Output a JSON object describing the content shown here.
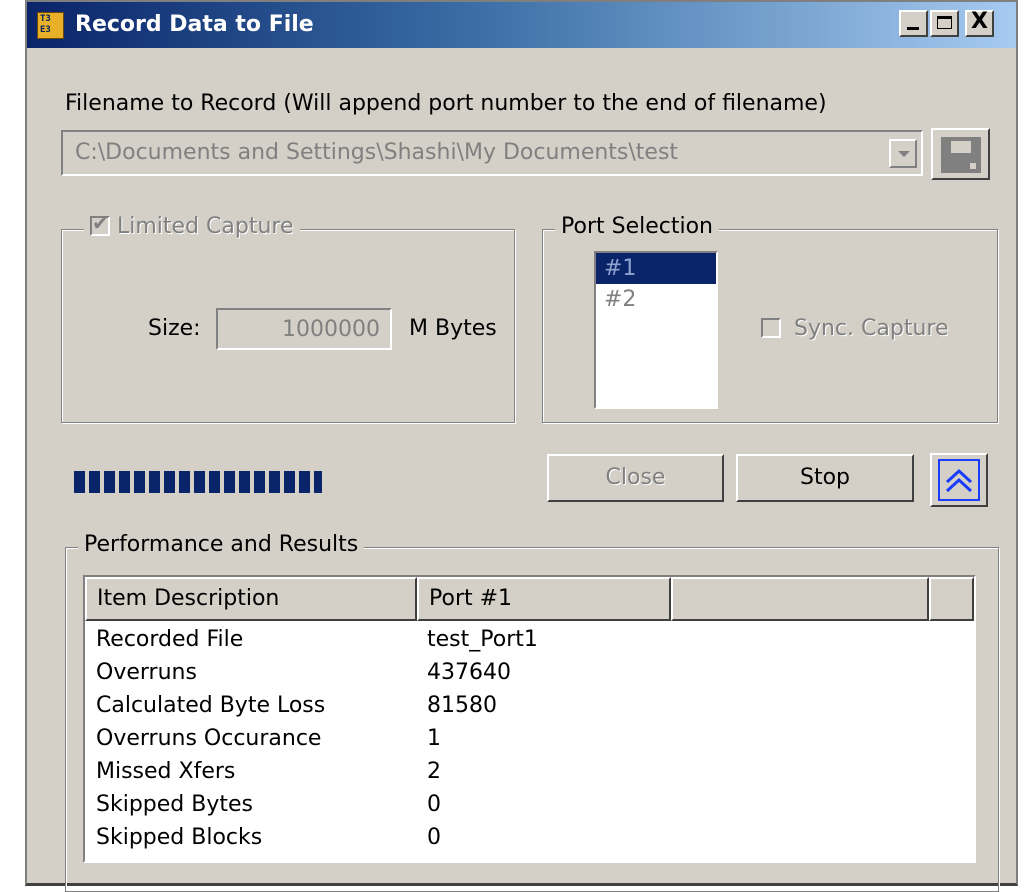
{
  "window": {
    "title": "Record Data to File",
    "app_icon_text": [
      "T3",
      "E3"
    ],
    "controls": {
      "close": "X"
    }
  },
  "filename": {
    "label": "Filename to Record (Will append port number to the end of filename)",
    "value": "C:\\Documents and Settings\\Shashi\\My Documents\\test"
  },
  "limited_capture": {
    "label": "Limited Capture",
    "checked": true,
    "size_label": "Size:",
    "size_value": "1000000",
    "size_unit": "M Bytes"
  },
  "port_selection": {
    "label": "Port Selection",
    "items": [
      "#1",
      "#2"
    ],
    "selected": "#1",
    "sync_capture_label": "Sync. Capture",
    "sync_capture_checked": false
  },
  "progress": {
    "value_fraction": 0.98
  },
  "buttons": {
    "close": "Close",
    "stop": "Stop"
  },
  "results": {
    "label": "Performance and Results",
    "columns": [
      "Item Description",
      "Port #1",
      "",
      ""
    ],
    "rows": [
      [
        "Recorded File",
        "test_Port1"
      ],
      [
        "Overruns",
        "437640"
      ],
      [
        "Calculated Byte Loss",
        "81580"
      ],
      [
        "Overruns Occurance",
        "1"
      ],
      [
        "Missed Xfers",
        "2"
      ],
      [
        "Skipped Bytes",
        "0"
      ],
      [
        "Skipped Blocks",
        "0"
      ]
    ]
  },
  "colors": {
    "dialog_bg": "#d4d0c8",
    "selection": "#0a246a",
    "title_start": "#0a246a",
    "title_end": "#a6caf0",
    "collapse_icon": "#1a3cff"
  }
}
